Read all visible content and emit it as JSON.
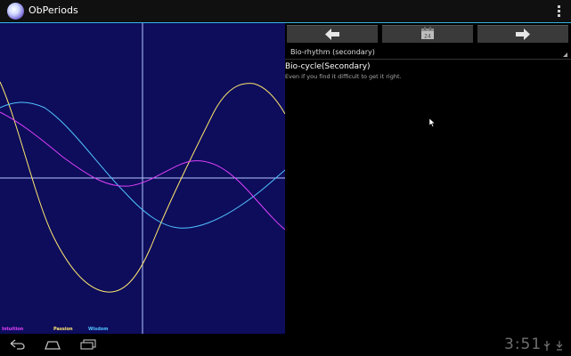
{
  "app": {
    "title": "ObPeriods",
    "icon": "app-icon"
  },
  "actionbar": {
    "overflow_icon": "overflow-menu-icon"
  },
  "chart": {
    "background": "#0d0d5c",
    "axis_color": "#b7c6ff",
    "legend": [
      {
        "label": "Intuition",
        "color": "#e040fb"
      },
      {
        "label": "Passion",
        "color": "#ffe66d"
      },
      {
        "label": "Wisdom",
        "color": "#52c3ff"
      }
    ]
  },
  "nav": {
    "prev_icon": "arrow-left-icon",
    "today_icon": "calendar-icon",
    "today_day": "24",
    "next_icon": "arrow-right-icon"
  },
  "dropdown": {
    "selected": "Bio-rhythm (secondary)"
  },
  "content": {
    "heading": "Bio-cycle(Secondary)",
    "description": "Even if you find it difficult to get it right."
  },
  "sysbar": {
    "back_icon": "back-icon",
    "home_icon": "home-icon",
    "recents_icon": "recents-icon",
    "time": "3:51",
    "status_icons": [
      "usb-icon",
      "download-icon"
    ]
  }
}
